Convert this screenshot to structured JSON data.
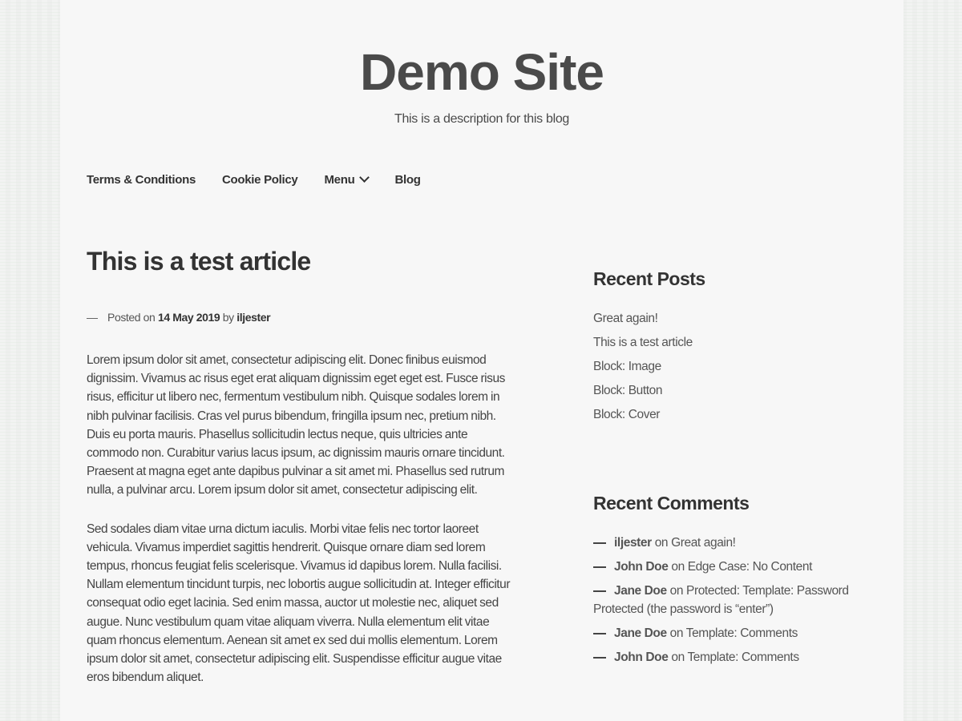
{
  "site": {
    "title": "Demo Site",
    "description": "This is a description for this blog"
  },
  "nav": {
    "items": [
      {
        "label": "Terms & Conditions",
        "has_dropdown": false
      },
      {
        "label": "Cookie Policy",
        "has_dropdown": false
      },
      {
        "label": "Menu",
        "has_dropdown": true,
        "icon": "chevron-down-icon"
      },
      {
        "label": "Blog",
        "has_dropdown": false
      }
    ]
  },
  "article": {
    "title": "This is a test article",
    "meta": {
      "posted_on_label": "Posted on",
      "date": "14 May 2019",
      "by_label": "by",
      "author": "iljester"
    },
    "paragraphs": [
      "Lorem ipsum dolor sit amet, consectetur adipiscing elit. Donec finibus euismod dignissim. Vivamus ac risus eget erat aliquam dignissim eget eget est. Fusce risus risus, efficitur ut libero nec, fermentum vestibulum nibh. Quisque sodales lorem in nibh pulvinar facilisis. Cras vel purus bibendum, fringilla ipsum nec, pretium nibh. Duis eu porta mauris. Phasellus sollicitudin lectus neque, quis ultricies ante commodo non. Curabitur varius lacus ipsum, ac dignissim mauris ornare tincidunt. Praesent at magna eget ante dapibus pulvinar a sit amet mi. Phasellus sed rutrum nulla, a pulvinar arcu. Lorem ipsum dolor sit amet, consectetur adipiscing elit.",
      "Sed sodales diam vitae urna dictum iaculis. Morbi vitae felis nec tortor laoreet vehicula. Vivamus imperdiet sagittis hendrerit. Quisque ornare diam sed lorem tempus, rhoncus feugiat felis scelerisque. Vivamus id dapibus lorem. Nulla facilisi. Nullam elementum tincidunt turpis, nec lobortis augue sollicitudin at. Integer efficitur consequat odio eget lacinia. Sed enim massa, auctor ut molestie nec, aliquet sed augue. Nunc vestibulum quam vitae aliquam viverra. Nulla elementum elit vitae quam rhoncus elementum. Aenean sit amet ex sed dui mollis elementum. Lorem ipsum dolor sit amet, consectetur adipiscing elit. Suspendisse efficitur augue vitae eros bibendum aliquet."
    ]
  },
  "sidebar": {
    "recent_posts": {
      "title": "Recent Posts",
      "items": [
        "Great again!",
        "This is a test article",
        "Block: Image",
        "Block: Button",
        "Block: Cover"
      ]
    },
    "recent_comments": {
      "title": "Recent Comments",
      "on_label": "on",
      "items": [
        {
          "author": "iljester",
          "post": "Great again!"
        },
        {
          "author": "John Doe",
          "post": "Edge Case: No Content"
        },
        {
          "author": "Jane Doe",
          "post": "Protected: Template: Password Protected (the password is “enter”)"
        },
        {
          "author": "Jane Doe",
          "post": "Template: Comments"
        },
        {
          "author": "John Doe",
          "post": "Template: Comments"
        }
      ]
    }
  }
}
